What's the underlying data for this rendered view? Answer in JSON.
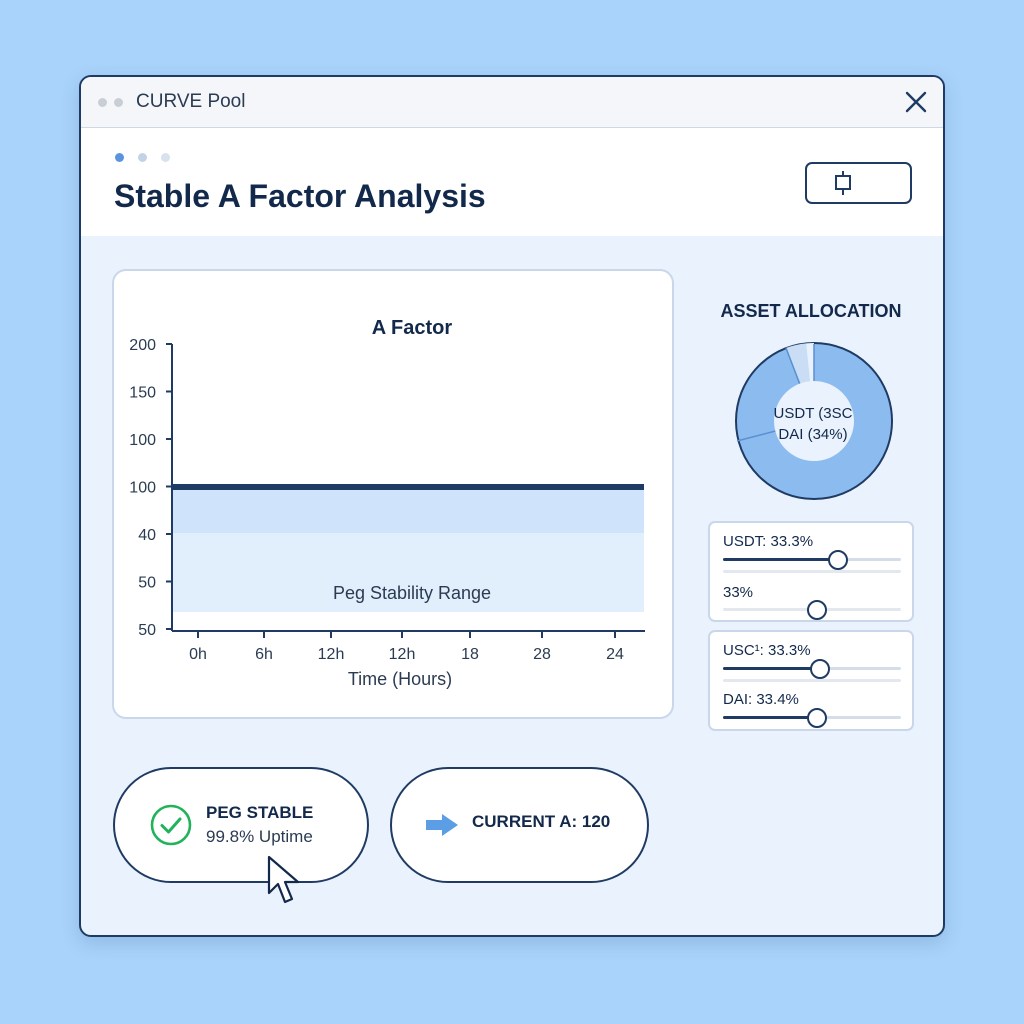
{
  "window": {
    "title": "CURVE Pool"
  },
  "header": {
    "title": "Stable A Factor Analysis"
  },
  "chart_data": {
    "type": "line",
    "title": "A Factor",
    "xlabel": "Time (Hours)",
    "ylabel": "",
    "y_tick_labels": [
      "200",
      "150",
      "100",
      "100",
      "40",
      "50",
      "50"
    ],
    "x_tick_labels": [
      "0h",
      "6h",
      "12h",
      "12h",
      "18",
      "28",
      "24"
    ],
    "series": [
      {
        "values": [
          100,
          100,
          100,
          100,
          100,
          100,
          100
        ]
      }
    ],
    "band_label": "Peg Stability Range",
    "grid": false,
    "legend": "none"
  },
  "allocation": {
    "title": "ASSET ALLOCATION",
    "donut_line1": "USDT (3SC",
    "donut_line2": "DAI (34%)",
    "slider_group_1": [
      {
        "label": "USDT: 33.3%",
        "value_fraction": 0.64
      },
      {
        "label": "33%",
        "value_fraction": 0.52
      }
    ],
    "slider_group_2": [
      {
        "label": "USC¹: 33.3%",
        "value_fraction": 0.54
      },
      {
        "label": "DAI: 33.4%",
        "value_fraction": 0.52
      }
    ]
  },
  "status": {
    "peg_title": "PEG STABLE",
    "peg_subtitle": "99.8% Uptime",
    "current_a": "CURRENT A: 120"
  },
  "colors": {
    "accent": "#1f3b63",
    "band_upper": "#cfe3fa",
    "band_lower": "#e1eefc",
    "success": "#22b35a",
    "arrow": "#5b9ee6",
    "donut_main": "#8cbcef"
  },
  "icons": [
    "close-icon",
    "device-icon",
    "check-circle-icon",
    "arrow-right-icon",
    "mouse-cursor-icon"
  ]
}
